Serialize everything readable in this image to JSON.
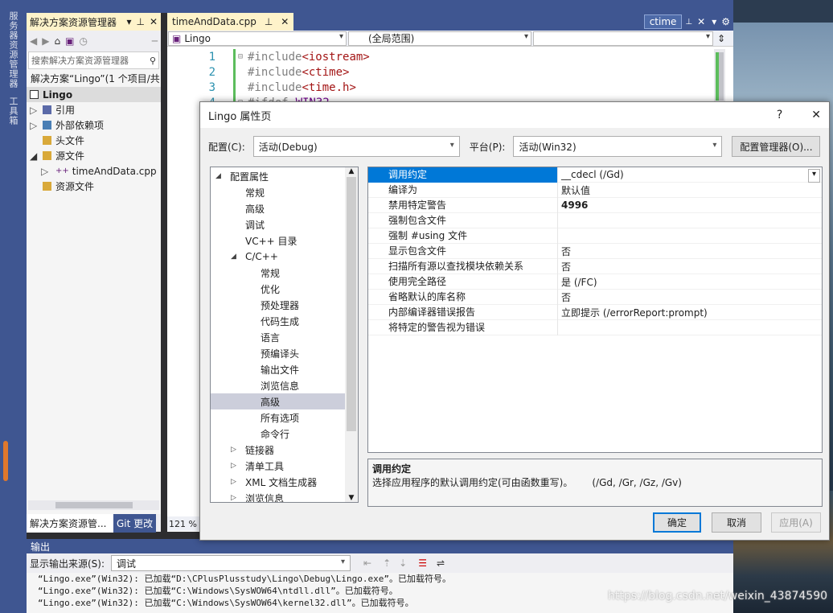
{
  "left_bar": {
    "item1": "服务器资源管理器",
    "item2": "工具箱"
  },
  "solution_explorer": {
    "title": "解决方案资源管理器",
    "search_placeholder": "搜索解决方案资源管理器",
    "root": "解决方案“Lingo”(1 个项目/共",
    "project": "Lingo",
    "items": [
      "引用",
      "外部依赖项",
      "头文件",
      "源文件",
      "timeAndData.cpp",
      "资源文件"
    ],
    "bottom_tab": "解决方案资源管...",
    "git_tab": "Git 更改"
  },
  "editor": {
    "tab": "timeAndData.cpp",
    "right_tab": "ctime",
    "nav1": "Lingo",
    "nav2": "(全局范围)",
    "nav3": "",
    "lines": [
      {
        "n": "1",
        "pre": "#include",
        "inc": "<iostream>"
      },
      {
        "n": "2",
        "pre": "#include",
        "inc": "<ctime>"
      },
      {
        "n": "3",
        "pre": "#include",
        "inc": "<time.h>"
      },
      {
        "n": "4",
        "pre": "#ifdef",
        "inc": "WIN32"
      }
    ],
    "zoom": "121 %"
  },
  "dialog": {
    "title": "Lingo 属性页",
    "help": "?",
    "config_label": "配置(C):",
    "config_value": "活动(Debug)",
    "platform_label": "平台(P):",
    "platform_value": "活动(Win32)",
    "config_mgr": "配置管理器(O)...",
    "tree": [
      "配置属性",
      "常规",
      "高级",
      "调试",
      "VC++ 目录",
      "C/C++",
      "常规",
      "优化",
      "预处理器",
      "代码生成",
      "语言",
      "预编译头",
      "输出文件",
      "浏览信息",
      "高级",
      "所有选项",
      "命令行",
      "链接器",
      "清单工具",
      "XML 文档生成器",
      "浏览信息"
    ],
    "props": [
      {
        "k": "调用约定",
        "v": "__cdecl (/Gd)"
      },
      {
        "k": "编译为",
        "v": "默认值"
      },
      {
        "k": "禁用特定警告",
        "v": "4996"
      },
      {
        "k": "强制包含文件",
        "v": ""
      },
      {
        "k": "强制 #using 文件",
        "v": ""
      },
      {
        "k": "显示包含文件",
        "v": "否"
      },
      {
        "k": "扫描所有源以查找模块依赖关系",
        "v": "否"
      },
      {
        "k": "使用完全路径",
        "v": "是 (/FC)"
      },
      {
        "k": "省略默认的库名称",
        "v": "否"
      },
      {
        "k": "内部编译器错误报告",
        "v": "立即提示 (/errorReport:prompt)"
      },
      {
        "k": "将特定的警告视为错误",
        "v": ""
      }
    ],
    "desc_title": "调用约定",
    "desc_text": "选择应用程序的默认调用约定(可由函数重写)。",
    "desc_opts": "(/Gd, /Gr, /Gz, /Gv)",
    "ok": "确定",
    "cancel": "取消",
    "apply": "应用(A)"
  },
  "output": {
    "title": "输出",
    "source_label": "显示输出来源(S):",
    "source_value": "调试",
    "lines": [
      "“Lingo.exe”(Win32): 已加载“D:\\CPlusPlusstudy\\Lingo\\Debug\\Lingo.exe”。已加载符号。",
      "“Lingo.exe”(Win32): 已加载“C:\\Windows\\SysWOW64\\ntdll.dll”。已加载符号。",
      "“Lingo.exe”(Win32): 已加载“C:\\Windows\\SysWOW64\\kernel32.dll”。已加载符号。"
    ]
  },
  "watermark": "https://blog.csdn.net/weixin_43874590",
  "colors": {
    "vs_blue": "#3f5691",
    "tab_yellow": "#fef3ca",
    "select": "#0078d7",
    "accent": "#0078d7"
  }
}
